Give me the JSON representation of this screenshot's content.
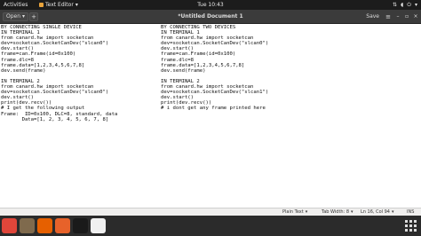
{
  "topbar": {
    "activities_label": "Activities",
    "app_name": "Text Editor",
    "clock": "Tue 10:43",
    "tray_icons": [
      "network-icon",
      "volume-icon",
      "power-icon"
    ]
  },
  "header": {
    "open_label": "Open",
    "document_title": "*Untitled Document 1",
    "save_label": "Save"
  },
  "editor": {
    "left_lines": [
      "BY CONNECTING SINGLE DEVICE",
      "IN TERMINAL 1",
      "from canard.hw import socketcan",
      "dev=socketcan.SocketCanDev(\"slcan0\")",
      "dev.start()",
      "frame=can.Frame(id=0x100)",
      "frame.dlc=8",
      "frame.data=[1,2,3,4,5,6,7,8]",
      "dev.send(frame)",
      "",
      "IN TERMINAL 2",
      "from canard.hw import socketcan",
      "dev=socketcan.SocketCanDev(\"slcan0\")",
      "dev.start()",
      "print(dev.recv())",
      "# I get the following output",
      "Frame:  ID=0x100, DLC=8, standard, data",
      "       Data=[1, 2, 3, 4, 5, 6, 7, 8]"
    ],
    "right_lines": [
      "BY CONNECTING TWO DEVICES",
      "IN TERMINAL 1",
      "from canard.hw import socketcan",
      "dev=socketcan.SocketCanDev(\"slcan0\")",
      "dev.start()",
      "frame=can.Frame(id=0x100)",
      "frame.dlc=8",
      "frame.data=[1,2,3,4,5,6,7,8]",
      "dev.send(frame)",
      "",
      "IN TERMINAL 2",
      "from canard.hw import socketcan",
      "dev=socketcan.SocketCanDev(\"slcan1\")",
      "dev.start()",
      "print(dev.recv())",
      "# i dont get any frame printed here"
    ]
  },
  "statusbar": {
    "language": "Plain Text",
    "tab_width": "Tab Width: 8",
    "position": "Ln 16, Col 94",
    "mode": "INS"
  },
  "dock": {
    "apps": [
      {
        "name": "chrome-icon",
        "color": "#e0463a"
      },
      {
        "name": "files-icon",
        "color": "#7f6a4d"
      },
      {
        "name": "firefox-icon",
        "color": "#e66000"
      },
      {
        "name": "software-icon",
        "color": "#e7622a"
      },
      {
        "name": "terminal-icon",
        "color": "#1a1a1a"
      },
      {
        "name": "text-editor-icon",
        "color": "#f0f0f0"
      }
    ]
  }
}
